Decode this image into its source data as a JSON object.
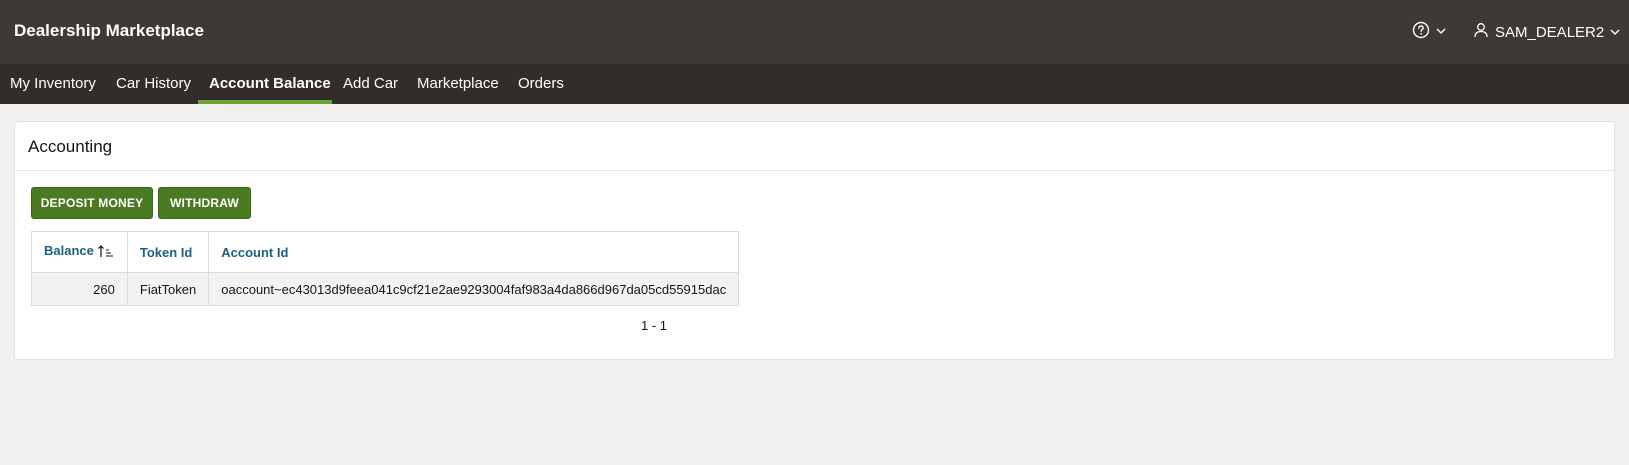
{
  "header": {
    "app_title": "Dealership Marketplace",
    "help_icon": "help-circle-icon",
    "user": {
      "name": "SAM_DEALER2",
      "icon": "user-icon"
    }
  },
  "nav": {
    "items": [
      {
        "label": "My Inventory",
        "active": false
      },
      {
        "label": "Car History",
        "active": false
      },
      {
        "label": "Account Balance",
        "active": true
      },
      {
        "label": "Add Car",
        "active": false
      },
      {
        "label": "Marketplace",
        "active": false
      },
      {
        "label": "Orders",
        "active": false
      }
    ],
    "active_color": "#6fa23b"
  },
  "region": {
    "title": "Accounting",
    "buttons": {
      "deposit_label": "DEPOSIT MONEY",
      "withdraw_label": "WITHDRAW"
    },
    "button_color": "#4a7a22",
    "table": {
      "columns": [
        "Balance",
        "Token Id",
        "Account Id"
      ],
      "sort": {
        "column": "Balance",
        "direction": "ascending",
        "icon": "sort-ascending-icon"
      },
      "rows": [
        {
          "balance": "260",
          "token_id": "FiatToken",
          "account_id": "oaccount~ec43013d9feea041c9cf21e2ae9293004faf983a4da866d967da05cd55915dac"
        }
      ]
    },
    "pagination": "1 - 1"
  }
}
